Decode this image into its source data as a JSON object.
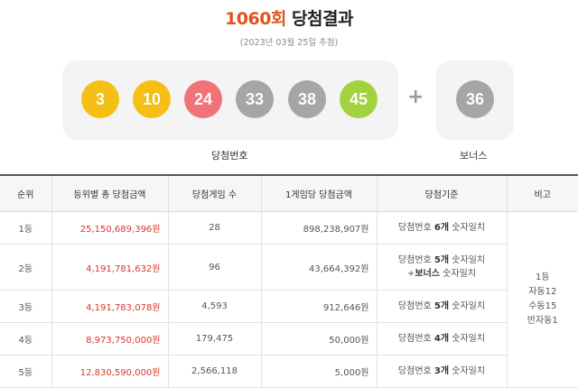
{
  "header": {
    "round": "1060회",
    "title": "당첨결과",
    "date": "(2023년 03월 25일 추첨)"
  },
  "balls": {
    "main": [
      {
        "number": "3",
        "color": "#f5bf16"
      },
      {
        "number": "10",
        "color": "#f5bf16"
      },
      {
        "number": "24",
        "color": "#f2727a"
      },
      {
        "number": "33",
        "color": "#a6a6a6"
      },
      {
        "number": "38",
        "color": "#a6a6a6"
      },
      {
        "number": "45",
        "color": "#a3d23f"
      }
    ],
    "plus": "+",
    "bonus": {
      "number": "36",
      "color": "#a6a6a6"
    },
    "main_label": "당첨번호",
    "bonus_label": "보너스"
  },
  "table": {
    "headers": [
      "순위",
      "등위별 총 당첨금액",
      "당첨게임 수",
      "1게임당 당첨금액",
      "당첨기준",
      "비고"
    ],
    "rows": [
      {
        "rank": "1등",
        "total": "25,150,689,396원",
        "games": "28",
        "per_game": "898,238,907원",
        "crit_pre": "당첨번호 ",
        "crit_bold": "6개",
        "crit_post": " 숫자일치"
      },
      {
        "rank": "2등",
        "total": "4,191,781,632원",
        "games": "96",
        "per_game": "43,664,392원",
        "crit_pre": "당첨번호 ",
        "crit_bold": "5개",
        "crit_post": " 숫자일치",
        "crit2_pre": "+",
        "crit2_bold": "보너스",
        "crit2_post": " 숫자일치"
      },
      {
        "rank": "3등",
        "total": "4,191,783,078원",
        "games": "4,593",
        "per_game": "912,646원",
        "crit_pre": "당첨번호 ",
        "crit_bold": "5개",
        "crit_post": " 숫자일치"
      },
      {
        "rank": "4등",
        "total": "8,973,750,000원",
        "games": "179,475",
        "per_game": "50,000원",
        "crit_pre": "당첨번호 ",
        "crit_bold": "4개",
        "crit_post": " 숫자일치"
      },
      {
        "rank": "5등",
        "total": "12,830,590,000원",
        "games": "2,566,118",
        "per_game": "5,000원",
        "crit_pre": "당첨번호 ",
        "crit_bold": "3개",
        "crit_post": " 숫자일치"
      }
    ],
    "note": [
      "1등",
      "자동12",
      "수동15",
      "반자동1"
    ]
  }
}
